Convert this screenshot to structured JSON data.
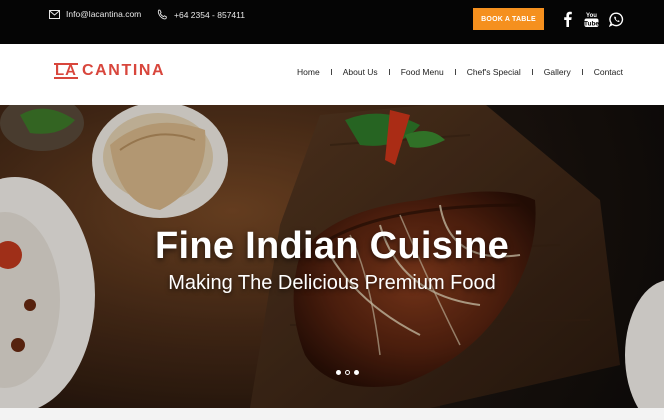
{
  "topbar": {
    "email": "Info@lacantina.com",
    "phone": "+64 2354 - 857411",
    "book_button": "BOOK A TABLE",
    "email_icon": "mail-icon",
    "phone_icon": "phone-icon",
    "social_icons": [
      "facebook-icon",
      "youtube-icon",
      "whatsapp-icon"
    ]
  },
  "logo": {
    "la": "LA",
    "name": "CANTINA",
    "color": "#d8463c"
  },
  "nav": {
    "items": [
      "Home",
      "About Us",
      "Food Menu",
      "Chef's Special",
      "Gallery",
      "Contact"
    ]
  },
  "hero": {
    "title": "Fine Indian Cuisine",
    "subtitle": "Making The Delicious Premium Food",
    "slides": 3,
    "active_slide": 1
  },
  "colors": {
    "accent": "#f5901e",
    "topbar": "#050505",
    "brand": "#d8463c"
  }
}
